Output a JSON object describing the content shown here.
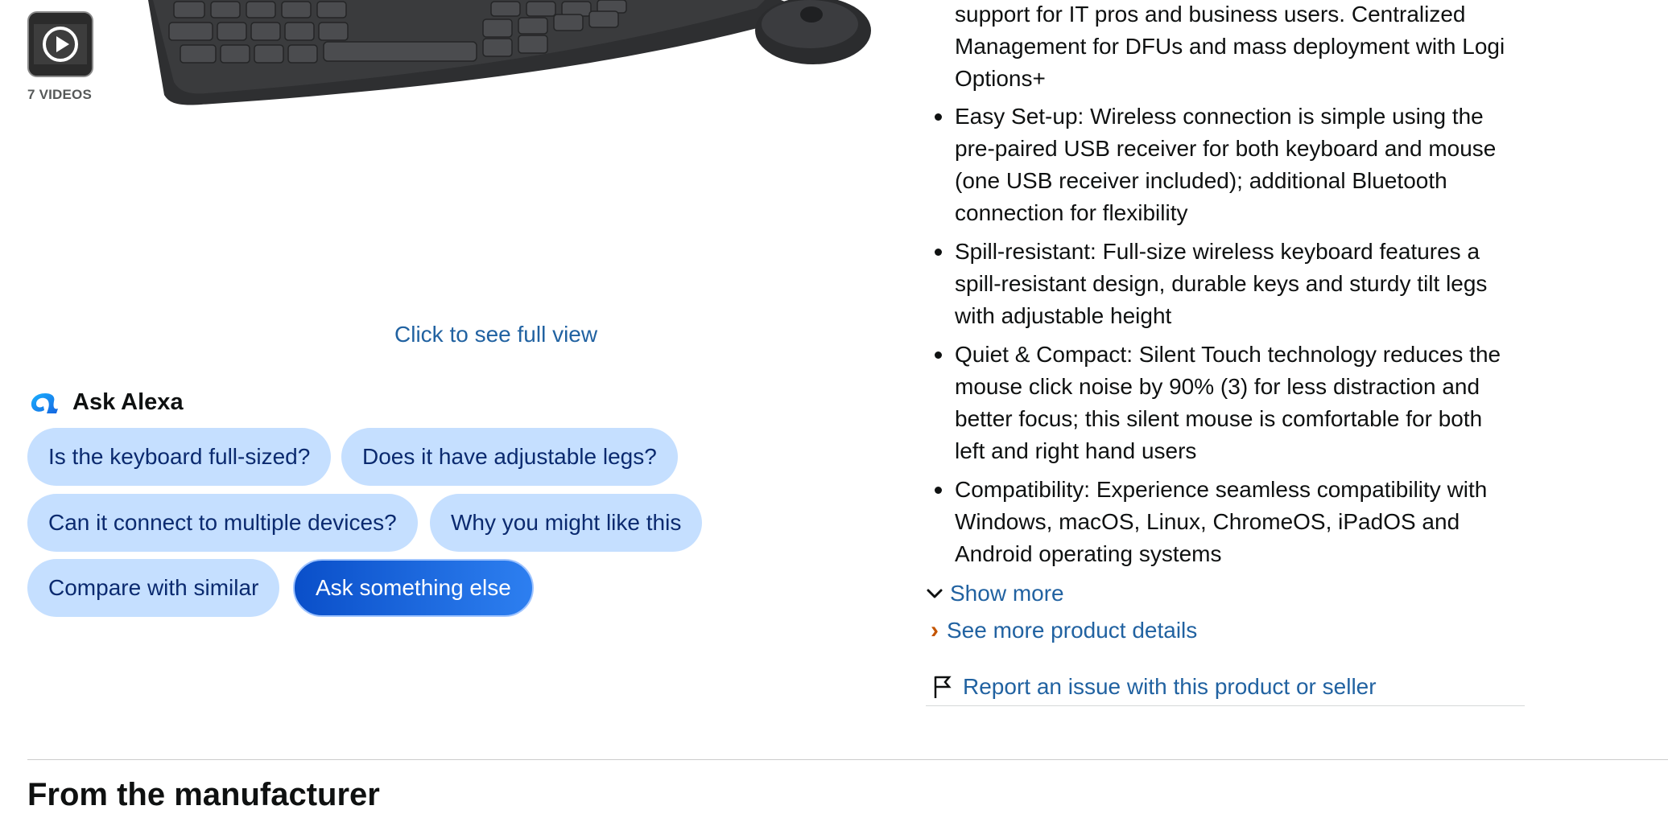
{
  "media": {
    "video_count_label": "7 VIDEOS",
    "full_view_link": "Click to see full view",
    "icons": {
      "video_thumb": "play-icon"
    }
  },
  "ask_alexa": {
    "title": "Ask Alexa",
    "icon": "alexa-icon",
    "chips": [
      "Is the keyboard full-sized?",
      "Does it have adjustable legs?",
      "Can it connect to multiple devices?",
      "Why you might like this",
      "Compare with similar",
      "Ask something else"
    ],
    "colors": {
      "chip_bg": "#c5dfff",
      "chip_text": "#0b2a6f",
      "primary_bg": "#0a4fc9"
    }
  },
  "about": {
    "partial_bullet": [
      "support for IT pros and business users. Centralized",
      "Management for DFUs and mass deployment with Logi",
      "Options+"
    ],
    "bullets": [
      [
        "Easy Set-up: Wireless connection is simple using the",
        "pre-paired USB receiver for both keyboard and mouse",
        "(one USB receiver included); additional Bluetooth",
        "connection for flexibility"
      ],
      [
        "Spill-resistant: Full-size wireless keyboard features a",
        "spill-resistant design, durable keys and sturdy tilt legs",
        "with adjustable height"
      ],
      [
        "Quiet & Compact: Silent Touch technology reduces the",
        "mouse click noise by 90% (3) for less distraction and",
        "better focus; this silent mouse is comfortable for both",
        "left and right hand users"
      ],
      [
        "Compatibility: Experience seamless compatibility with",
        "Windows, macOS, Linux, ChromeOS, iPadOS and",
        "Android operating systems"
      ]
    ],
    "show_more": "Show more",
    "see_more_details": "See more product details",
    "report_issue": "Report an issue with this product or seller",
    "icons": {
      "show_more": "chevron-down-icon",
      "see_more": "chevron-right-icon",
      "report": "flag-icon"
    },
    "colors": {
      "link": "#2162a1",
      "accent": "#c45500"
    }
  },
  "manufacturer": {
    "title": "From the manufacturer"
  }
}
